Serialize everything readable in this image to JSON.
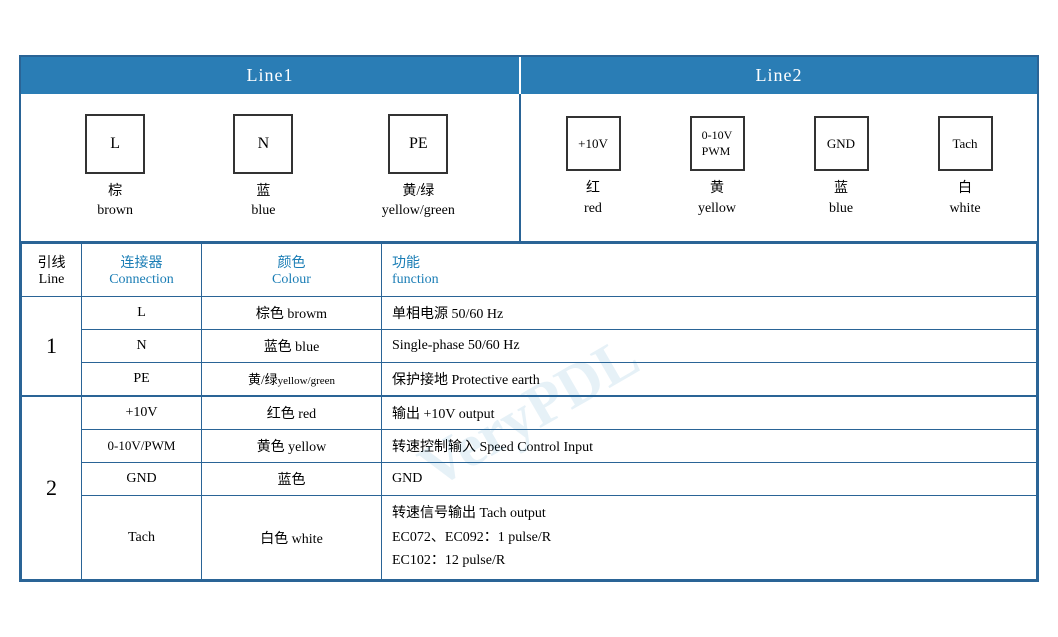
{
  "header": {
    "line1": "Line1",
    "line2": "Line2"
  },
  "diagram": {
    "line1": [
      {
        "label": "L",
        "sublabel_zh": "棕",
        "sublabel_en": "brown"
      },
      {
        "label": "N",
        "sublabel_zh": "蓝",
        "sublabel_en": "blue"
      },
      {
        "label": "PE",
        "sublabel_zh": "黄/绿",
        "sublabel_en": "yellow/green"
      }
    ],
    "line2": [
      {
        "label": "+10V",
        "sublabel_zh": "红",
        "sublabel_en": "red"
      },
      {
        "label": "0-10V\nPWM",
        "sublabel_zh": "黄",
        "sublabel_en": "yellow"
      },
      {
        "label": "GND",
        "sublabel_zh": "蓝",
        "sublabel_en": "blue"
      },
      {
        "label": "Tach",
        "sublabel_zh": "白",
        "sublabel_en": "white"
      }
    ]
  },
  "table": {
    "headers": {
      "line_zh": "引线",
      "line_en": "Line",
      "conn_zh": "连接器",
      "conn_en": "Connection",
      "color_zh": "颜色",
      "color_en": "Colour",
      "func_zh": "功能",
      "func_en": "function"
    },
    "rows": [
      {
        "line": "1",
        "subrows": [
          {
            "conn": "L",
            "color": "棕色 browm",
            "func": "单相电源 50/60 Hz"
          },
          {
            "conn": "N",
            "color": "蓝色 blue",
            "func": "Single-phase 50/60 Hz"
          },
          {
            "conn": "PE",
            "color": "黄/绿yellow/green",
            "func": "保护接地 Protective earth"
          }
        ]
      },
      {
        "line": "2",
        "subrows": [
          {
            "conn": "+10V",
            "color": "红色 red",
            "func": "输出 +10V output"
          },
          {
            "conn": "0-10V/PWM",
            "color": "黄色 yellow",
            "func": "转速控制输入 Speed Control Input"
          },
          {
            "conn": "GND",
            "color": "蓝色",
            "func": "GND"
          },
          {
            "conn": "Tach",
            "color": "白色 white",
            "func": "转速信号输出 Tach output\nEC072、EC092：1 pulse/R\nEC102：12 pulse/R"
          }
        ]
      }
    ]
  }
}
